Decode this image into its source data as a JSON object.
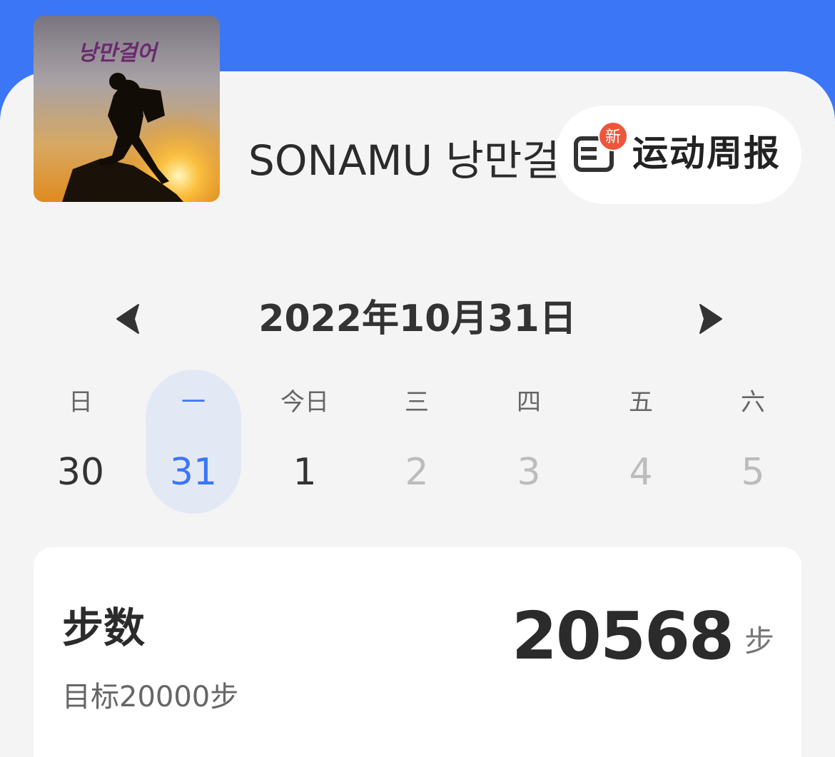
{
  "profile": {
    "avatar_icon": "hiker-silhouette-sunset",
    "avatar_text": "낭만걸어",
    "username": "SONAMU 낭만걸어"
  },
  "weekly_report": {
    "icon": "report-card-icon",
    "badge": "新",
    "label": "运动周报"
  },
  "date_nav": {
    "title": "2022年10月31日",
    "prev_icon": "triangle-left",
    "next_icon": "triangle-right"
  },
  "week": [
    {
      "weekday": "日",
      "day": "30",
      "state": "past"
    },
    {
      "weekday": "一",
      "day": "31",
      "state": "selected"
    },
    {
      "weekday": "今日",
      "day": "1",
      "state": "today"
    },
    {
      "weekday": "三",
      "day": "2",
      "state": "future"
    },
    {
      "weekday": "四",
      "day": "3",
      "state": "future"
    },
    {
      "weekday": "五",
      "day": "4",
      "state": "future"
    },
    {
      "weekday": "六",
      "day": "5",
      "state": "future"
    }
  ],
  "steps_card": {
    "title": "步数",
    "goal": "目标20000步",
    "value": "20568",
    "unit": "步"
  },
  "colors": {
    "header": "#3b76f6",
    "background": "#f4f4f4",
    "accent": "#3b76f6",
    "selected_day_bg": "#e3e9f4",
    "badge": "#f0553c"
  }
}
